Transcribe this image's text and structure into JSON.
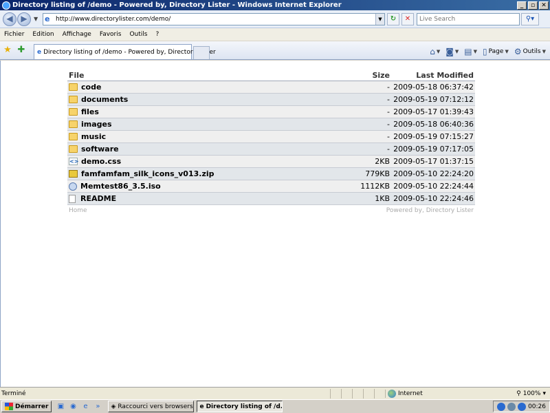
{
  "window": {
    "title": "Directory listing of /demo - Powered by, Directory Lister - Windows Internet Explorer",
    "min_label": "_",
    "max_label": "▫",
    "close_label": "✕"
  },
  "address": {
    "url": "http://www.directorylister.com/demo/",
    "search_placeholder": "Live Search"
  },
  "menu": [
    "Fichier",
    "Edition",
    "Affichage",
    "Favoris",
    "Outils",
    "?"
  ],
  "tabs": {
    "active_title": "Directory listing of /demo - Powered by, Directory Lister"
  },
  "commandbar": {
    "page_label": "Page",
    "tools_label": "Outils"
  },
  "listing": {
    "headers": {
      "file": "File",
      "size": "Size",
      "modified": "Last Modified"
    },
    "rows": [
      {
        "name": "code",
        "size": "-",
        "modified": "2009-05-18 06:37:42",
        "icon": "folder"
      },
      {
        "name": "documents",
        "size": "-",
        "modified": "2009-05-19 07:12:12",
        "icon": "folder"
      },
      {
        "name": "files",
        "size": "-",
        "modified": "2009-05-17 01:39:43",
        "icon": "folder"
      },
      {
        "name": "images",
        "size": "-",
        "modified": "2009-05-18 06:40:36",
        "icon": "folder"
      },
      {
        "name": "music",
        "size": "-",
        "modified": "2009-05-19 07:15:27",
        "icon": "folder"
      },
      {
        "name": "software",
        "size": "-",
        "modified": "2009-05-19 07:17:05",
        "icon": "folder"
      },
      {
        "name": "demo.css",
        "size": "2KB",
        "modified": "2009-05-17 01:37:15",
        "icon": "css"
      },
      {
        "name": "famfamfam_silk_icons_v013.zip",
        "size": "779KB",
        "modified": "2009-05-10 22:24:20",
        "icon": "zip"
      },
      {
        "name": "Memtest86_3.5.iso",
        "size": "1112KB",
        "modified": "2009-05-10 22:24:44",
        "icon": "iso"
      },
      {
        "name": "README",
        "size": "1KB",
        "modified": "2009-05-10 22:24:46",
        "icon": "file"
      }
    ],
    "footer": {
      "home": "Home",
      "powered_prefix": "Powered by,",
      "powered_link": "Directory Lister"
    }
  },
  "status": {
    "text": "Terminé",
    "zone": "Internet",
    "zoom": "100%"
  },
  "taskbar": {
    "start_label": "Démarrer",
    "tasks": [
      "Raccourci vers browsers...",
      "Directory listing of /d..."
    ],
    "clock": "00:26"
  }
}
